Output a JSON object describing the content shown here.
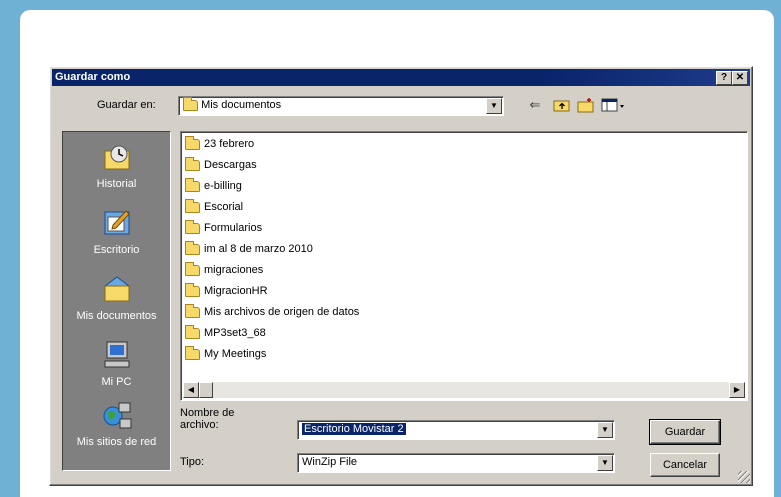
{
  "dialog": {
    "title": "Guardar como",
    "help_label": "?",
    "close_label": "✕"
  },
  "save_in": {
    "label": "Guardar en:",
    "value": "Mis documentos"
  },
  "toolbar": {
    "back_label": "⇐"
  },
  "places": [
    {
      "label": "Historial",
      "icon": "history-icon"
    },
    {
      "label": "Escritorio",
      "icon": "desktop-icon"
    },
    {
      "label": "Mis documentos",
      "icon": "my-documents-icon"
    },
    {
      "label": "Mi PC",
      "icon": "my-computer-icon"
    },
    {
      "label": "Mis sitios de red",
      "icon": "network-places-icon"
    }
  ],
  "files": [
    "23 febrero",
    "Descargas",
    "e-billing",
    "Escorial",
    "Formularios",
    "im al 8 de marzo 2010",
    "migraciones",
    "MigracionHR",
    "Mis archivos de origen de datos",
    "MP3set3_68",
    "My Meetings"
  ],
  "filename": {
    "label_line1": "Nombre de",
    "label_line2": "archivo:",
    "value": "Escritorio Movistar 2"
  },
  "filetype": {
    "label": "Tipo:",
    "value": "WinZip File"
  },
  "buttons": {
    "save": "Guardar",
    "cancel": "Cancelar"
  }
}
